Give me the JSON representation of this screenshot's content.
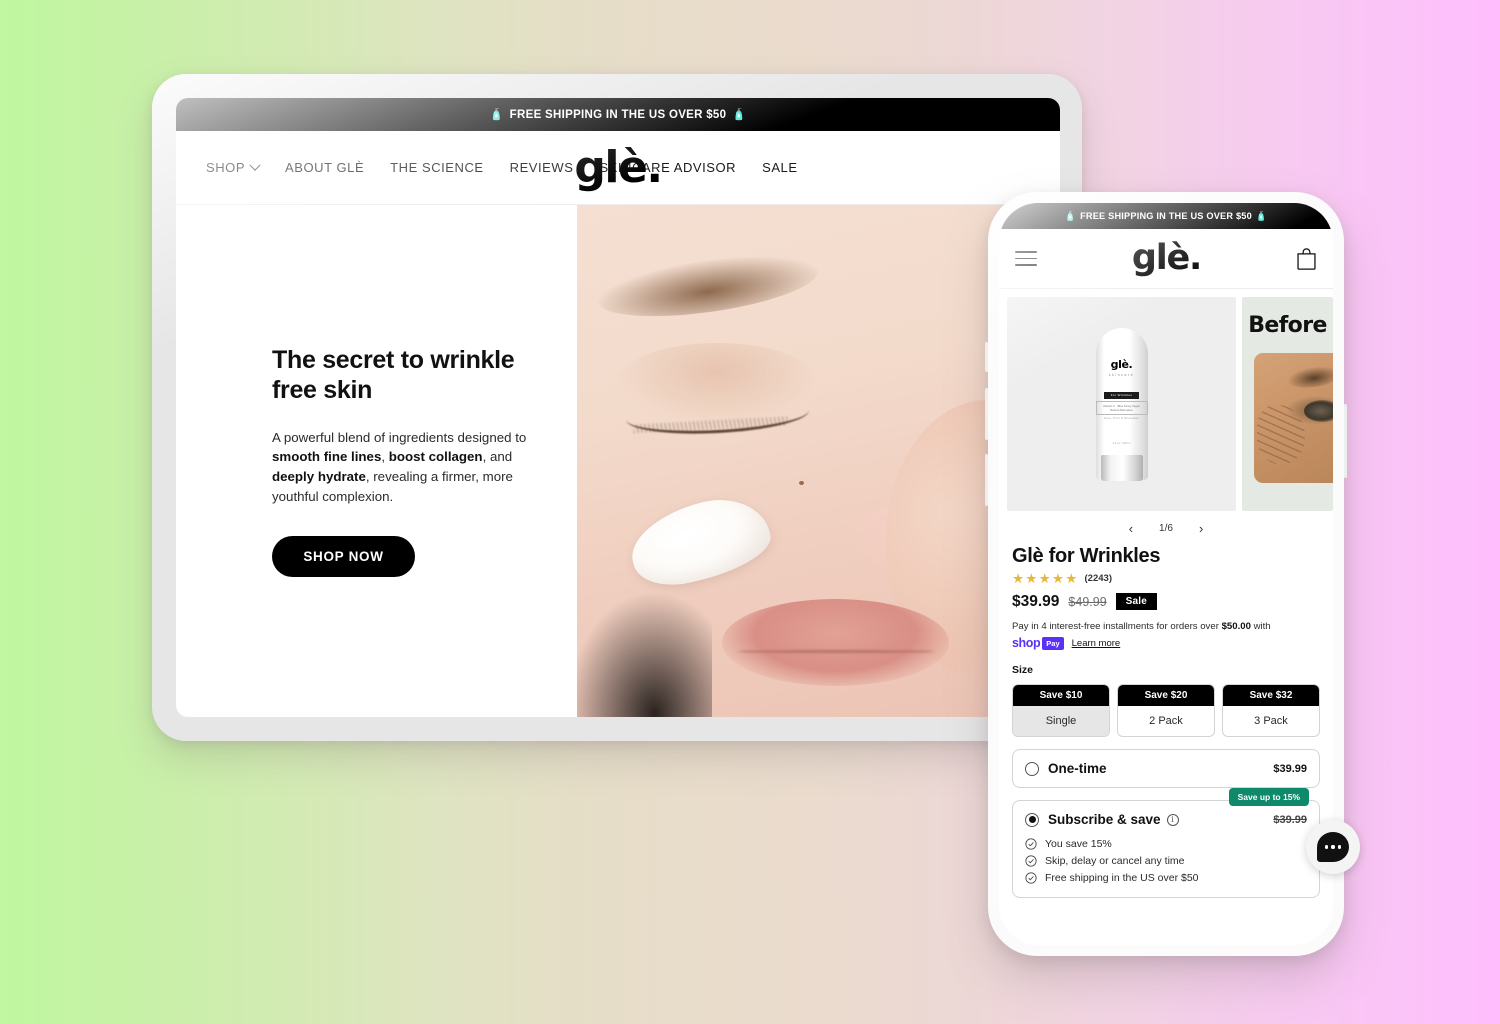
{
  "background": {
    "from": "#c0f7a0",
    "mid": "#e9dccb",
    "to": "#ffbdfd"
  },
  "tablet": {
    "announcement": "FREE SHIPPING IN THE US OVER $50",
    "announcement_emoji": "🧴",
    "nav": [
      {
        "label": "SHOP",
        "has_caret": true
      },
      {
        "label": "ABOUT GLÈ",
        "has_caret": false
      },
      {
        "label": "THE SCIENCE",
        "has_caret": false
      },
      {
        "label": "REVIEWS",
        "has_caret": false
      },
      {
        "label": "SKINCARE ADVISOR",
        "has_caret": false
      },
      {
        "label": "SALE",
        "has_caret": false
      }
    ],
    "logo": "glè.",
    "hero": {
      "heading": "The secret to wrinkle free skin",
      "body_1": "A powerful blend of ingredients designed to ",
      "body_b1": "smooth fine lines",
      "body_2": ", ",
      "body_b2": "boost collagen",
      "body_3": ", and ",
      "body_b3": "deeply hydrate",
      "body_4": ", revealing a firmer, more youthful complexion.",
      "cta": "SHOP NOW"
    }
  },
  "phone": {
    "announcement": "FREE SHIPPING IN THE US OVER $50",
    "announcement_emoji": "🧴",
    "logo": "glè.",
    "gallery": {
      "product_brand": "glè.",
      "product_sub": "skincare",
      "product_tag": "For Wrinkles",
      "product_ingredients": "Vitamin C  · Blue Tansy\nVegan Retinol Alternative",
      "product_claim": "Tone, Firm & Smoothen",
      "product_size": "4 fl oz / 118 ml",
      "before_label": "Before",
      "counter": "1/6",
      "prev": "‹",
      "next": "›"
    },
    "product": {
      "title": "Glè for Wrinkles",
      "stars": "★★★★★",
      "review_count": "(2243)",
      "price": "$39.99",
      "compare_at": "$49.99",
      "sale_badge": "Sale",
      "installments_1": "Pay in 4 interest-free installments for orders over ",
      "installments_amount": "$50.00",
      "installments_2": " with",
      "shop_word": "shop",
      "shop_pay": "Pay",
      "learn_more": "Learn more"
    },
    "size": {
      "label": "Size",
      "options": [
        {
          "badge": "Save $10",
          "name": "Single",
          "selected": true
        },
        {
          "badge": "Save $20",
          "name": "2 Pack",
          "selected": false
        },
        {
          "badge": "Save $32",
          "name": "3 Pack",
          "selected": false
        }
      ]
    },
    "purchase": {
      "onetime_label": "One-time",
      "onetime_price": "$39.99",
      "subscribe_label": "Subscribe & save",
      "subscribe_price": "$39.99",
      "save_badge": "Save up to 15%",
      "perks": [
        "You save 15%",
        "Skip, delay or cancel any time",
        "Free shipping in the US over $50"
      ]
    },
    "chat": {
      "icon": "chat-bubble-icon"
    }
  }
}
